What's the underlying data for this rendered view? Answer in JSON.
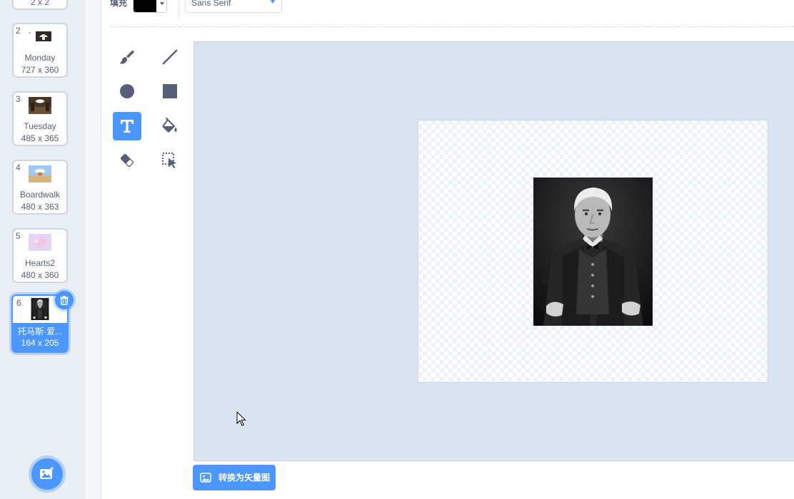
{
  "costume_list": {
    "items": [
      {
        "size": "2 x 2"
      },
      {
        "number": "2",
        "name": "Monday",
        "size": "727 x 360",
        "selected": false
      },
      {
        "number": "3",
        "name": "Tuesday",
        "size": "485 x 365",
        "selected": false
      },
      {
        "number": "4",
        "name": "Boardwalk",
        "size": "480 x 363",
        "selected": false
      },
      {
        "number": "5",
        "name": "Hearts2",
        "size": "480 x 360",
        "selected": false
      },
      {
        "number": "6",
        "name": "托马斯·爱...",
        "size": "164 x 205",
        "selected": true
      }
    ],
    "delete_icon": "trash-icon",
    "choose_costume_icon": "add-costume-icon"
  },
  "toolbar": {
    "fill_label": "填充",
    "fill_color": "#000000",
    "font": "Sans Serif"
  },
  "tools": [
    {
      "icon": "brush-icon",
      "selected": false
    },
    {
      "icon": "line-icon",
      "selected": false
    },
    {
      "icon": "circle-icon",
      "selected": false
    },
    {
      "icon": "rectangle-icon",
      "selected": false
    },
    {
      "icon": "text-icon",
      "selected": true
    },
    {
      "icon": "fill-icon",
      "selected": false
    },
    {
      "icon": "eraser-icon",
      "selected": false
    },
    {
      "icon": "select-icon",
      "selected": false
    }
  ],
  "convert_button": {
    "label": "转换为矢量图",
    "icon": "image-icon"
  },
  "colors": {
    "accent": "#4c97ff",
    "text": "#575e75",
    "sidebar": "#e9eef2",
    "canvas_area": "#d9e3f2"
  }
}
